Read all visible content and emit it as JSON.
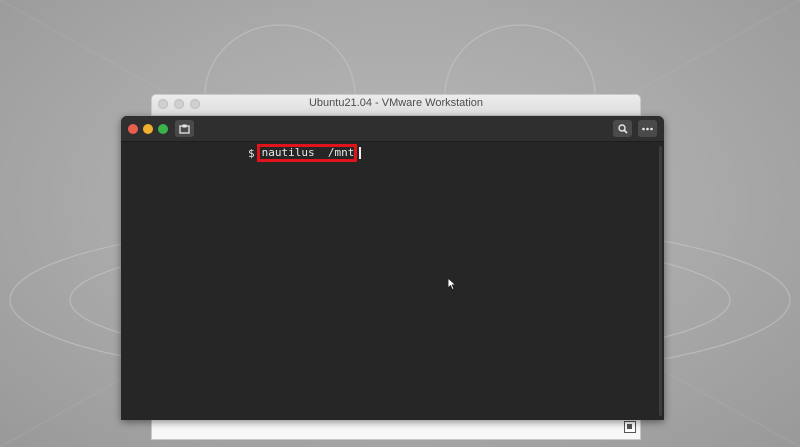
{
  "vm_window": {
    "title": "Ubuntu21.04 - VMware Workstation"
  },
  "terminal": {
    "prompt": "$",
    "command": "nautilus  /mnt",
    "icons": {
      "close": "close-icon",
      "minimize": "minimize-icon",
      "maximize": "maximize-icon",
      "new_tab": "new-tab-icon",
      "search": "search-icon",
      "menu": "hamburger-menu-icon"
    }
  },
  "colors": {
    "terminal_bg": "#262626",
    "highlight_box": "#e0141a",
    "close": "#e95e4f",
    "minimize": "#f3b02e",
    "maximize": "#3bb34b"
  }
}
